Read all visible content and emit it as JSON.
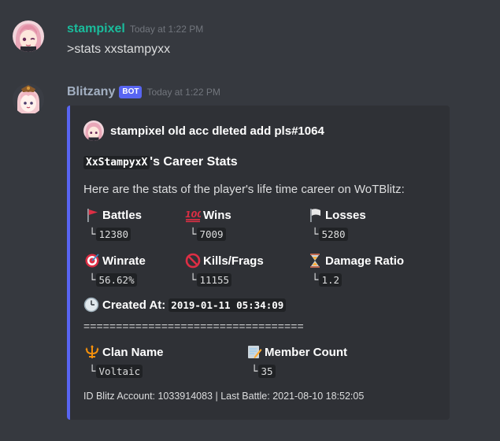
{
  "colors": {
    "background": "#36393f",
    "embed_background": "#2f3136",
    "embed_border": "#5865f2",
    "user1_name": "#1abc9c",
    "user2_name": "#a3b0c2",
    "bot_badge": "#5865f2"
  },
  "message1": {
    "username": "stampixel",
    "timestamp": "Today at 1:22 PM",
    "content": ">stats xxstampyxx"
  },
  "message2": {
    "username": "Blitzany",
    "badge": "BOT",
    "timestamp": "Today at 1:22 PM"
  },
  "embed": {
    "author": "stampixel old acc dleted add pls#1064",
    "title_code": "XxStampyxX",
    "title_suffix": "'s Career Stats",
    "description": "Here are the stats of the player's life time career on WoTBlitz:",
    "fields": [
      {
        "icon": "red-flag-icon",
        "name": "Battles",
        "value": "12380"
      },
      {
        "icon": "hundred-points-icon",
        "name": "Wins",
        "value": "7009"
      },
      {
        "icon": "white-flag-icon",
        "name": "Losses",
        "value": "5280"
      },
      {
        "icon": "direct-hit-icon",
        "name": "Winrate",
        "value": "56.62%"
      },
      {
        "icon": "no-entry-icon",
        "name": "Kills/Frags",
        "value": "11155"
      },
      {
        "icon": "hourglass-icon",
        "name": "Damage Ratio",
        "value": "1.2"
      }
    ],
    "created_label": "Created At:",
    "created_value": "2019-01-11 05:34:09",
    "separator": "==================================",
    "clan_fields": [
      {
        "icon": "trident-icon",
        "name": "Clan Name",
        "value": "Voltaic"
      },
      {
        "icon": "memo-icon",
        "name": "Member Count",
        "value": "35"
      }
    ],
    "tree_glyph": "└",
    "footer": "ID Blitz Account: 1033914083 | Last Battle: 2021-08-10 18:52:05"
  }
}
